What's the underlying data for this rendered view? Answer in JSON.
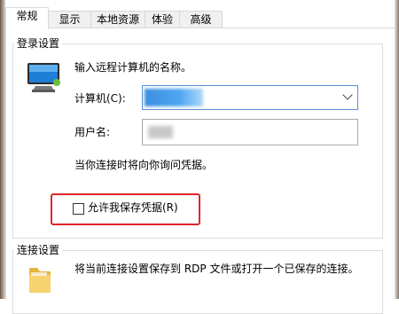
{
  "tabs": [
    {
      "label": "常规"
    },
    {
      "label": "显示"
    },
    {
      "label": "本地资源"
    },
    {
      "label": "体验"
    },
    {
      "label": "高级"
    }
  ],
  "login_group": {
    "title": "登录设置",
    "prompt": "输入远程计算机的名称。",
    "computer_label": "计算机(C):",
    "username_label": "用户名:",
    "credential_note": "当你连接时将向你询问凭据。",
    "save_credentials_label": "允许我保存凭据(R)",
    "save_credentials_checked": false
  },
  "connection_group": {
    "title": "连接设置",
    "description": "将当前连接设置保存到 RDP 文件或打开一个已保存的连接。"
  },
  "colors": {
    "highlight": "#e0262b",
    "combo_border": "#5b8fd6"
  }
}
